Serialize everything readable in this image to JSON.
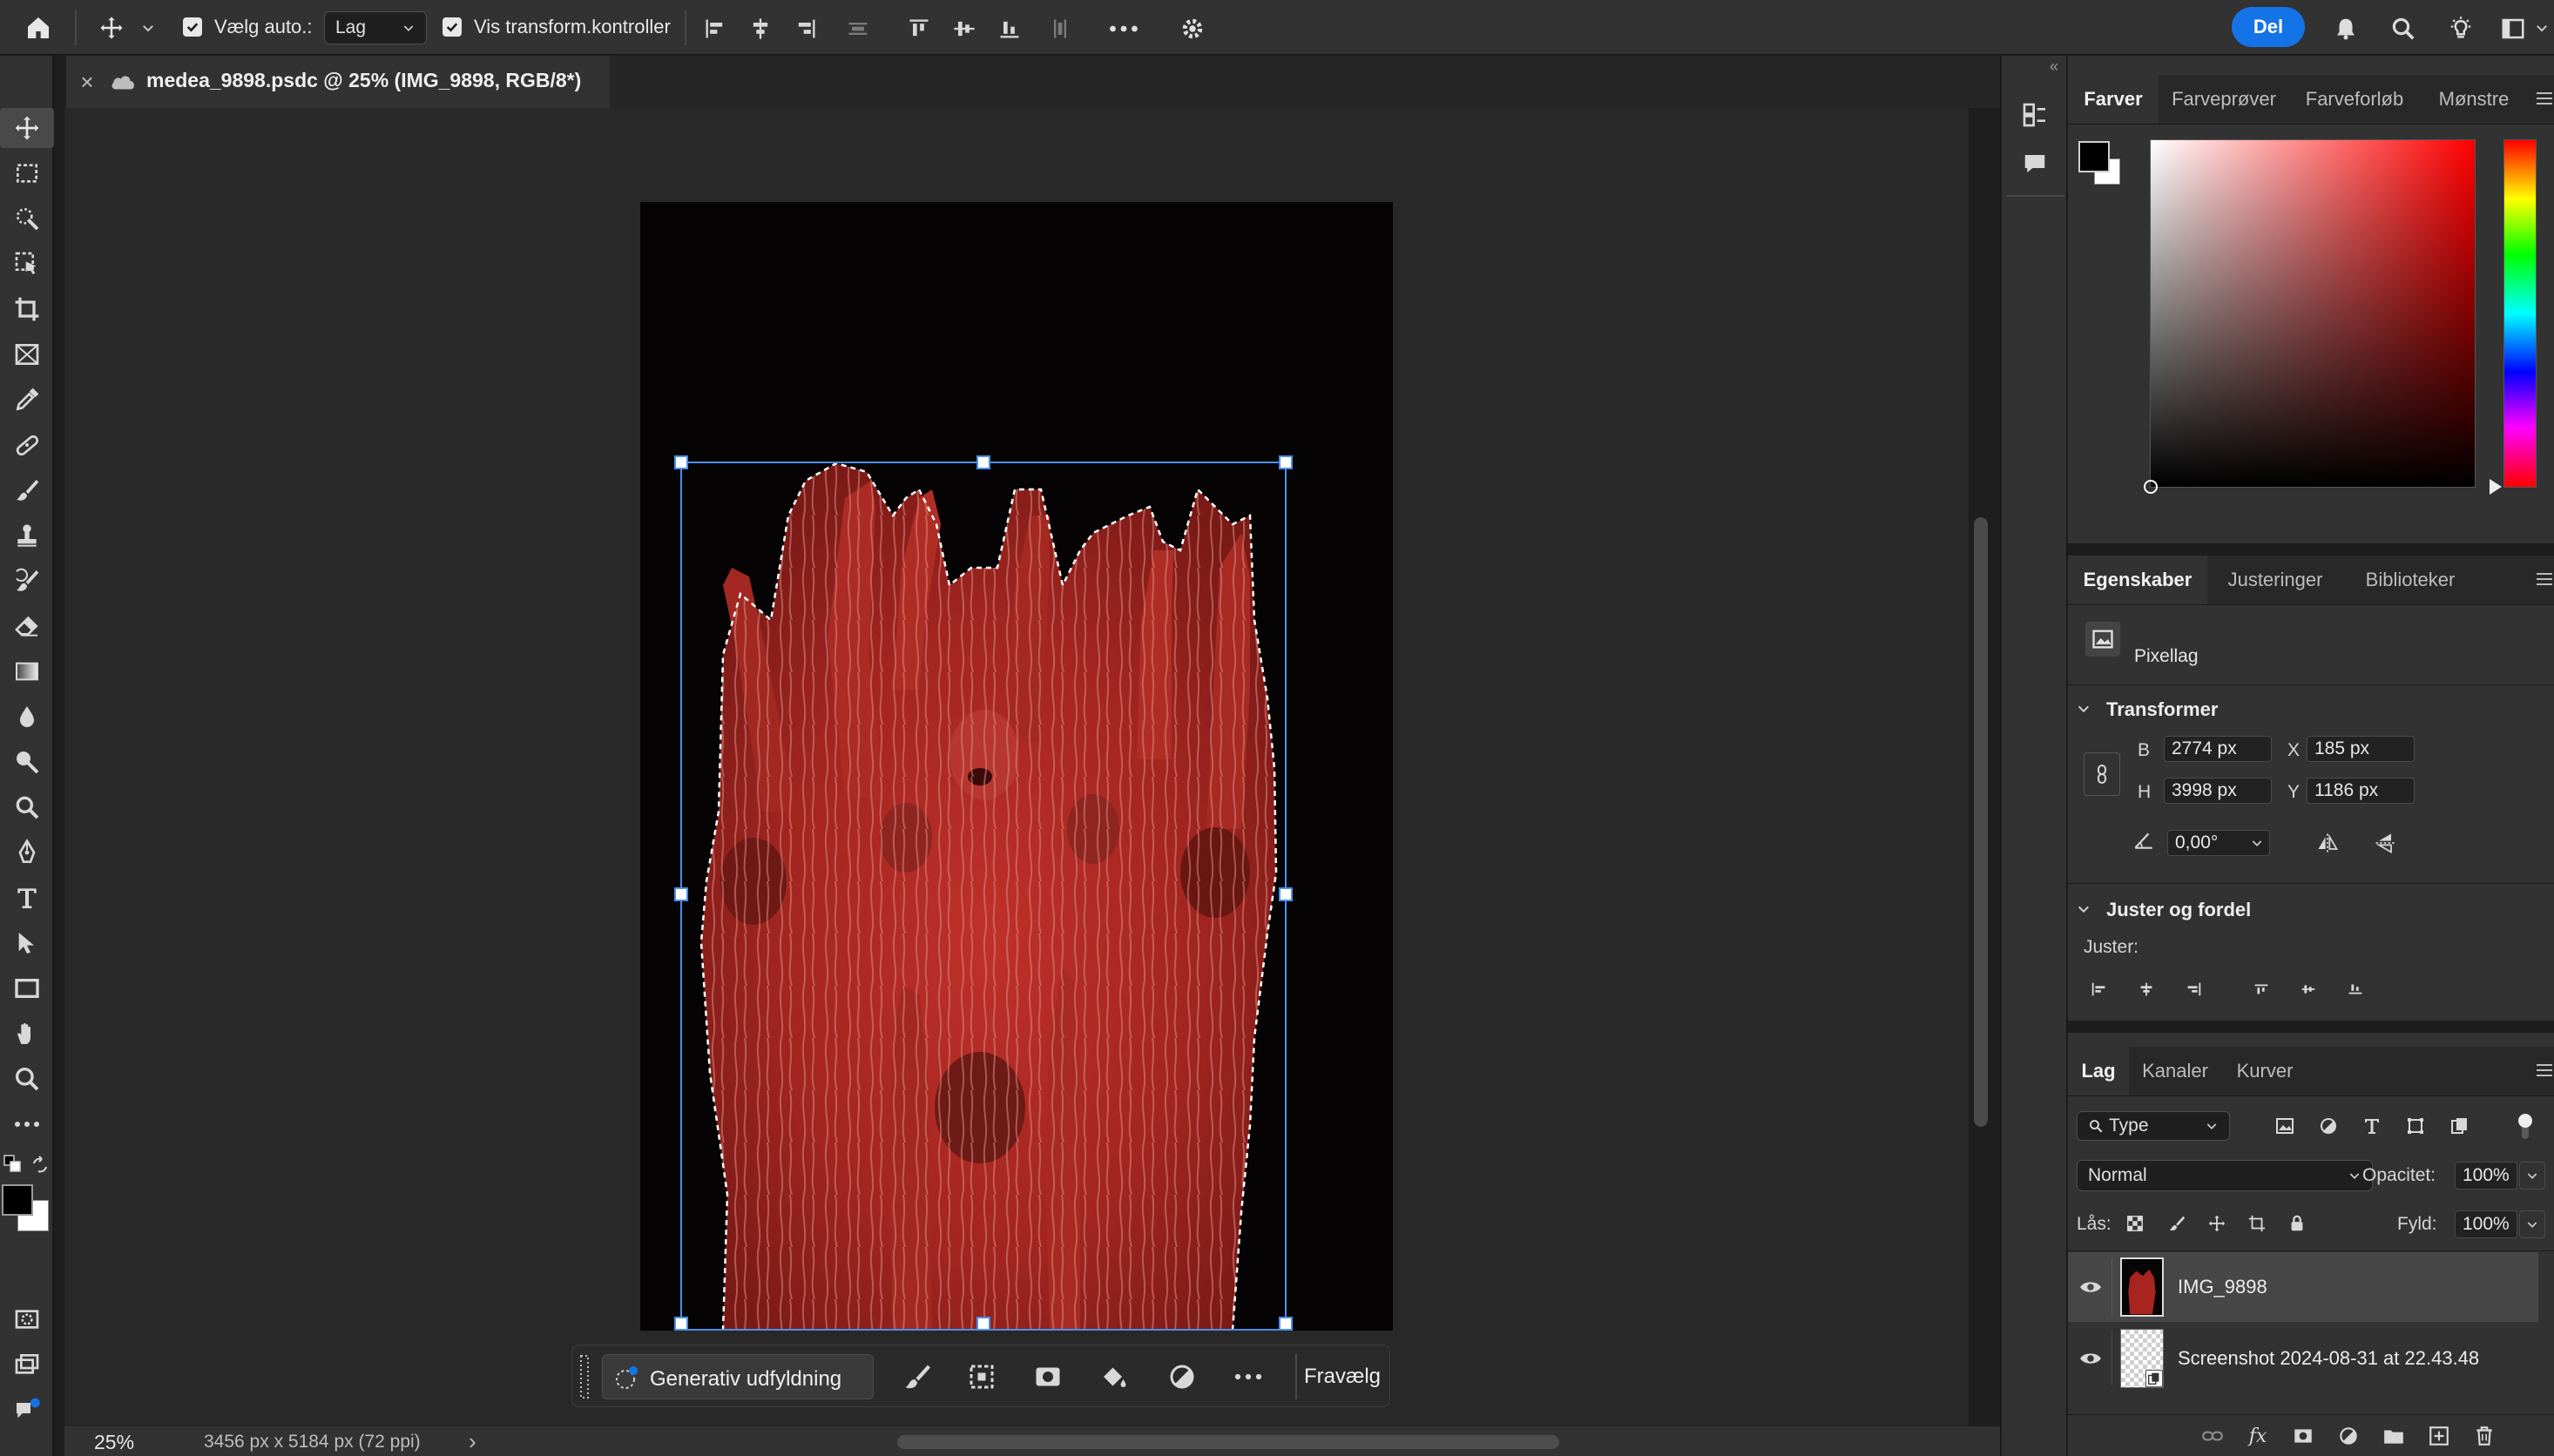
{
  "options_bar": {
    "auto_select_label": "Vælg auto.:",
    "auto_select_value": "Lag",
    "transform_controls_label": "Vis transform.kontroller",
    "share_button": "Del",
    "auto_select_checked": true,
    "transform_controls_checked": true
  },
  "document_tab": {
    "title": "medea_9898.psdc @ 25% (IMG_9898, RGB/8*)",
    "close_glyph": "×"
  },
  "context_bar": {
    "generative_fill": "Generativ udfyldning",
    "deselect": "Fravælg"
  },
  "status_bar": {
    "zoom": "25%",
    "doc_info": "3456 px x 5184 px (72 ppi)",
    "arrow": "›"
  },
  "color_panel": {
    "tabs": [
      "Farver",
      "Farveprøver",
      "Farveforløb",
      "Mønstre"
    ],
    "active_tab": 0,
    "hue": "#ff0000",
    "foreground": "#000000",
    "background": "#ffffff"
  },
  "properties_panel": {
    "tabs": [
      "Egenskaber",
      "Justeringer",
      "Biblioteker"
    ],
    "active_tab": 0,
    "layer_type": "Pixellag",
    "transform_title": "Transformer",
    "w_label": "B",
    "w_value": "2774 px",
    "h_label": "H",
    "h_value": "3998 px",
    "x_label": "X",
    "x_value": "185 px",
    "y_label": "Y",
    "y_value": "1186 px",
    "angle": "0,00°",
    "align_title": "Juster og fordel",
    "align_label": "Juster:"
  },
  "layers_panel": {
    "tabs": [
      "Lag",
      "Kanaler",
      "Kurver"
    ],
    "active_tab": 0,
    "filter_type": "Type",
    "blend_mode": "Normal",
    "opacity_label": "Opacitet:",
    "opacity_value": "100%",
    "lock_label": "Lås:",
    "fill_label": "Fyld:",
    "fill_value": "100%",
    "layers": [
      {
        "name": "IMG_9898",
        "visible": true,
        "selected": true
      },
      {
        "name": "Screenshot 2024-08-31 at 22.43.48",
        "visible": true,
        "selected": false
      }
    ]
  },
  "colors": {
    "accent": "#1473e6",
    "image_tint": "#a8241f",
    "selection_box": "#4a8fe7"
  }
}
